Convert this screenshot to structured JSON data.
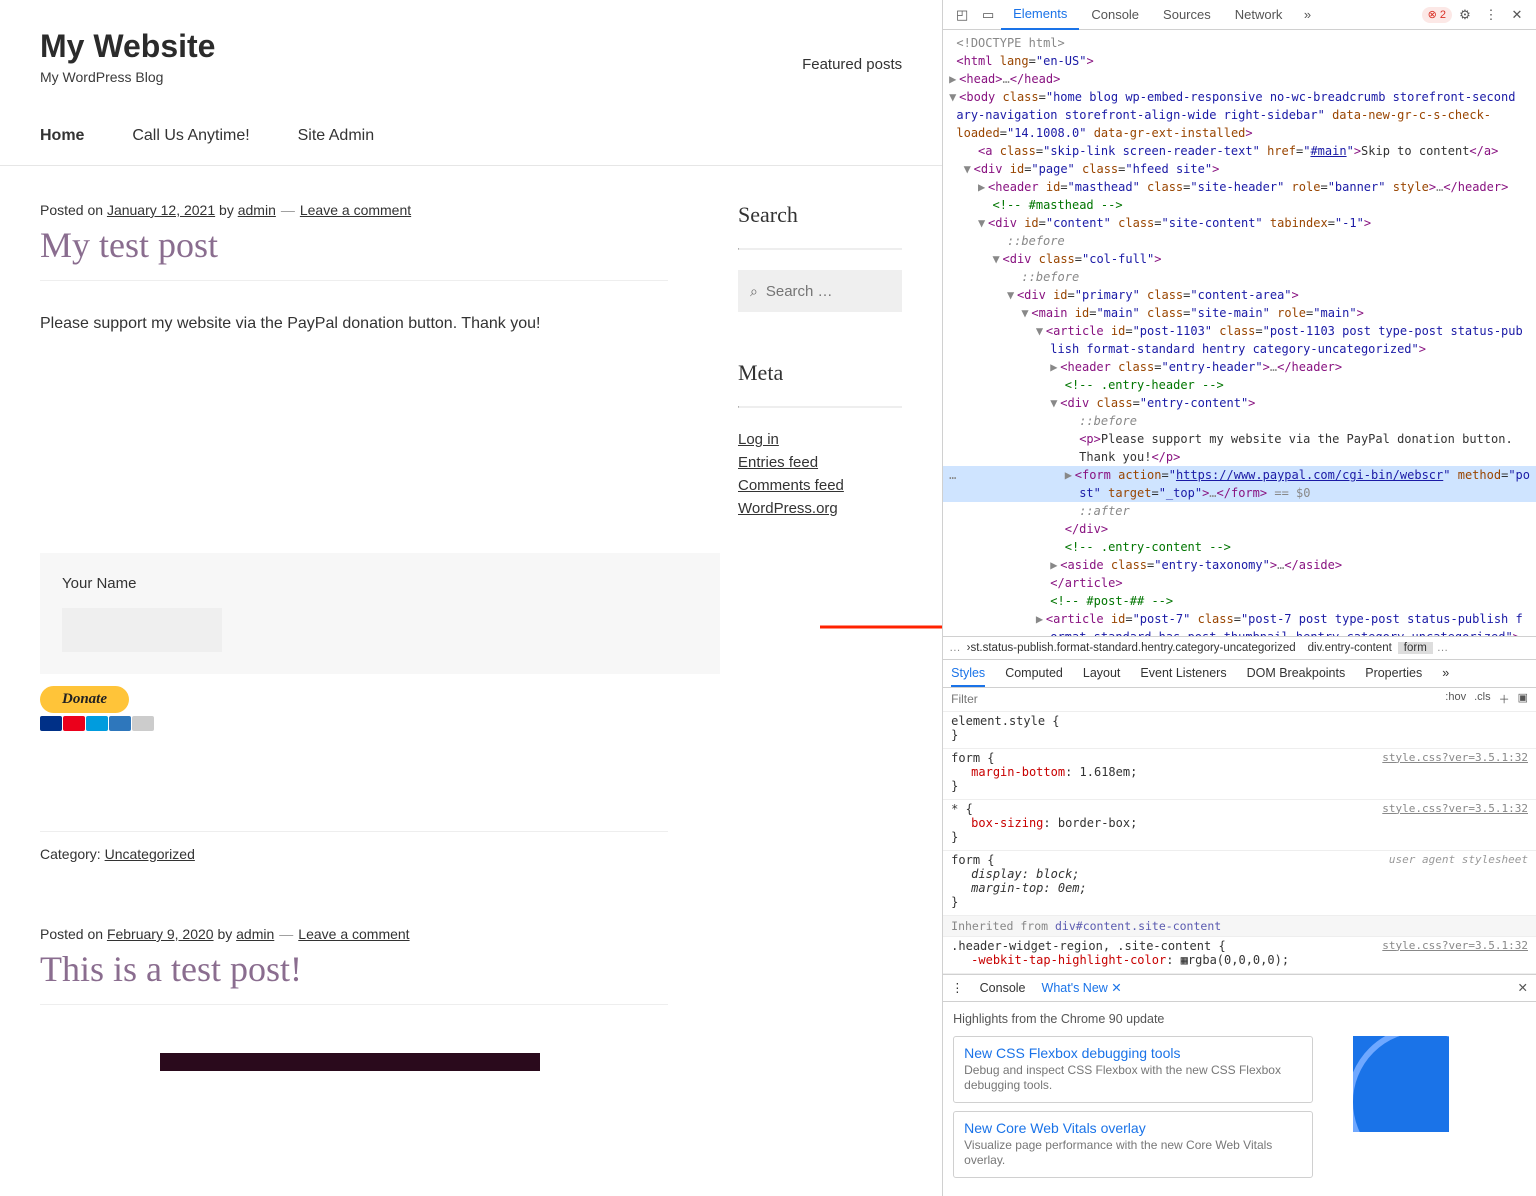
{
  "site": {
    "title": "My Website",
    "tagline": "My WordPress Blog",
    "featured": "Featured posts"
  },
  "nav": {
    "home": "Home",
    "call": "Call Us Anytime!",
    "admin": "Site Admin"
  },
  "post1": {
    "posted": "Posted on ",
    "date": "January 12, 2021",
    "by": " by ",
    "author": "admin",
    "comment": "Leave a comment",
    "title": "My test post",
    "body": "Please support my website via the PayPal donation button. Thank you!",
    "form_label": "Your Name",
    "donate": "Donate",
    "cat_label": "Category: ",
    "cat": "Uncategorized"
  },
  "post2": {
    "posted": "Posted on ",
    "date": "February 9, 2020",
    "by": " by ",
    "author": "admin",
    "comment": "Leave a comment",
    "title": "This is a test post!"
  },
  "sidebar": {
    "search_title": "Search",
    "search_ph": "Search …",
    "meta_title": "Meta",
    "links": [
      "Log in",
      "Entries feed",
      "Comments feed",
      "WordPress.org"
    ]
  },
  "devtools": {
    "tabs": [
      "Elements",
      "Console",
      "Sources",
      "Network"
    ],
    "err_count": "2",
    "crumb": {
      "a": "›st.status-publish.format-standard.hentry.category-uncategorized",
      "b": "div.entry-content",
      "c": "form"
    },
    "styles_tabs": [
      "Styles",
      "Computed",
      "Layout",
      "Event Listeners",
      "DOM Breakpoints",
      "Properties"
    ],
    "filter_ph": "Filter",
    "hov": ":hov",
    "cls": ".cls",
    "rules": {
      "src": "style.css?ver=3.5.1:32",
      "r0": "element.style {",
      "r0c": "}",
      "r1": "form {",
      "r1p": "margin-bottom",
      "r1v": "1.618em;",
      "r1c": "}",
      "r2": "* {",
      "r2p": "box-sizing",
      "r2v": "border-box;",
      "r2c": "}",
      "r3": "form {",
      "r3p1": "display",
      "r3v1": "block;",
      "r3p2": "margin-top",
      "r3v2": "0em;",
      "r3c": "}",
      "r3src": "user agent stylesheet",
      "inh": "Inherited from ",
      "inh2": "div#content.site-content",
      "r4": ".header-widget-region, .site-content {",
      "r4p": "-webkit-tap-highlight-color",
      "r4v": "rgba(0,0,0,0);",
      "r4c": "}"
    },
    "drawer": {
      "tabs": [
        "Console",
        "What's New"
      ],
      "headline": "Highlights from the Chrome 90 update",
      "c1t": "New CSS Flexbox debugging tools",
      "c1d": "Debug and inspect CSS Flexbox with the new CSS Flexbox debugging tools.",
      "c2t": "New Core Web Vitals overlay",
      "c2d": "Visualize page performance with the new Core Web Vitals overlay."
    }
  }
}
